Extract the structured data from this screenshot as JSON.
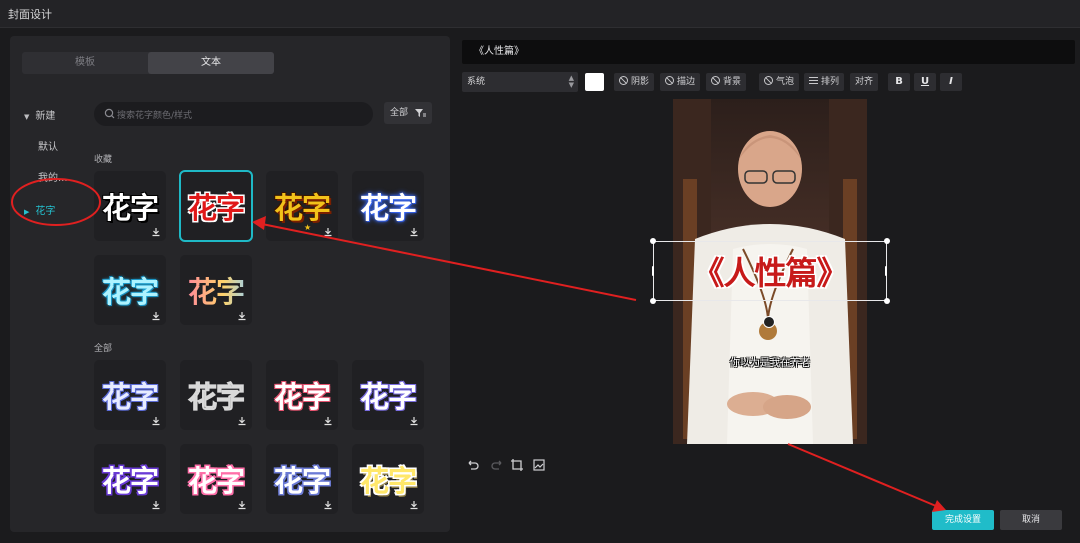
{
  "window": {
    "title": "封面设计"
  },
  "tabs": [
    {
      "label": "模板"
    },
    {
      "label": "文本"
    }
  ],
  "sidebar": {
    "items": [
      {
        "label": "新建",
        "expanded": true
      },
      {
        "label": "默认"
      },
      {
        "label": "我的..."
      },
      {
        "label": "花字",
        "active": true
      }
    ]
  },
  "search": {
    "placeholder": "搜索花字颜色/样式"
  },
  "filter": {
    "label": "全部"
  },
  "sections": {
    "favorites": {
      "label": "收藏",
      "tiles": [
        {
          "text": "花字",
          "style": "white-black",
          "selected": false
        },
        {
          "text": "花字",
          "style": "red-white",
          "selected": true
        },
        {
          "text": "花字",
          "style": "yellow-brown",
          "selected": false
        },
        {
          "text": "花字",
          "style": "blue-glow",
          "selected": false
        },
        {
          "text": "花字",
          "style": "cyan-glow",
          "selected": false
        },
        {
          "text": "花字",
          "style": "pink-gradient",
          "selected": false
        }
      ]
    },
    "all": {
      "label": "全部",
      "tiles": [
        {
          "text": "花字",
          "style": "pale-blue"
        },
        {
          "text": "花字",
          "style": "outline"
        },
        {
          "text": "花字",
          "style": "pink-white"
        },
        {
          "text": "花字",
          "style": "lilac"
        },
        {
          "text": "花字",
          "style": "purple-white"
        },
        {
          "text": "花字",
          "style": "pink-bubble"
        },
        {
          "text": "花字",
          "style": "blue-bubble"
        },
        {
          "text": "花字",
          "style": "yellow-bubble"
        }
      ]
    }
  },
  "editor": {
    "text_value": "《人性篇》",
    "font": "系统",
    "text_color": "#ffffff",
    "options": {
      "shadow": "阴影",
      "stroke": "描边",
      "background": "背景",
      "bubble": "气泡",
      "arrange": "排列",
      "align": "对齐"
    },
    "format": {
      "bold": "B",
      "underline": "U",
      "italic": "I"
    }
  },
  "preview": {
    "title": "《人性篇》",
    "subtitle": "你以为是我在养老"
  },
  "actions": {
    "confirm": "完成设置",
    "cancel": "取消"
  },
  "colors": {
    "accent": "#20bcc9",
    "annotation": "#e02020"
  }
}
